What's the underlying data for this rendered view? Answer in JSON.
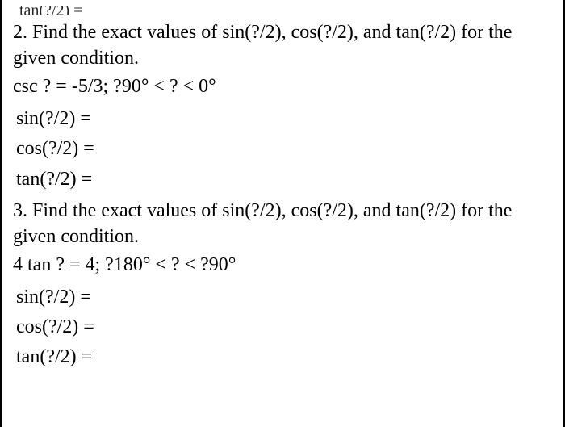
{
  "cutoff": "tan(?/2)  =",
  "q2": {
    "prompt": "2. Find the exact values of sin(?/2), cos(?/2), and tan(?/2) for the given condition.",
    "condition": "csc ? = -5/3; ?90° < ? < 0°",
    "answers": {
      "sin": "sin(?/2)  =",
      "cos": "cos(?/2)  =",
      "tan": "tan(?/2)  ="
    }
  },
  "q3": {
    "prompt": "3. Find the exact values of sin(?/2), cos(?/2), and tan(?/2) for the given condition.",
    "condition": "4 tan ? = 4; ?180° < ? < ?90°",
    "answers": {
      "sin": "sin(?/2)  =",
      "cos": "cos(?/2)  =",
      "tan": "tan(?/2)  ="
    }
  }
}
